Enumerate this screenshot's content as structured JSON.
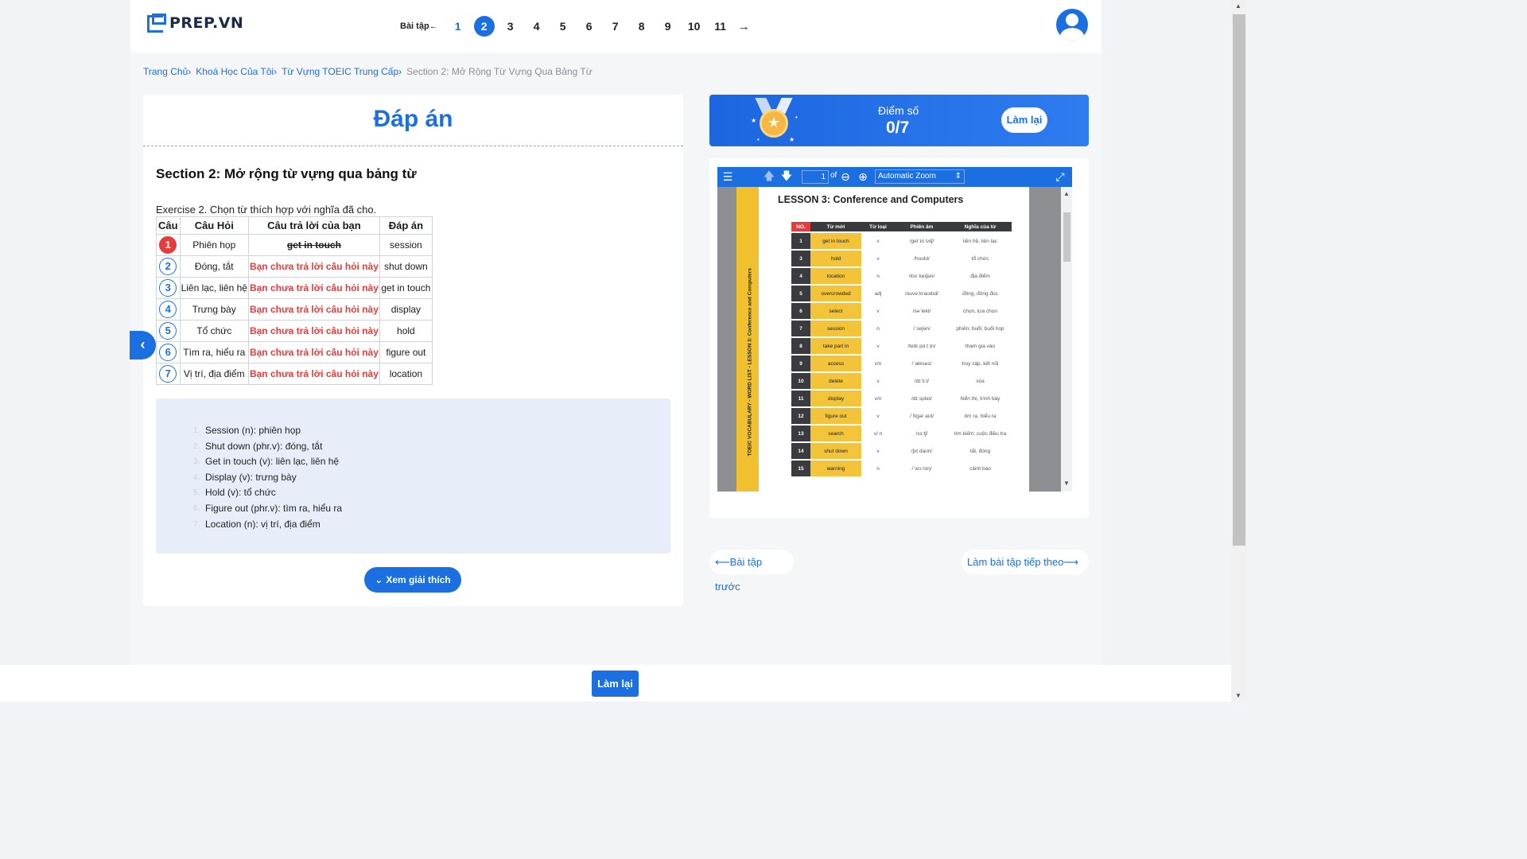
{
  "header": {
    "logo_text": "PREP.VN",
    "exercise_label": "Bài tập",
    "exercise_prev": "←",
    "exercise_next": "→",
    "exercises": [
      "1",
      "2",
      "3",
      "4",
      "5",
      "6",
      "7",
      "8",
      "9",
      "10",
      "11"
    ],
    "active_exercise": "2"
  },
  "breadcrumb": [
    "Trang Chủ",
    "Khoá Học Của Tôi",
    "Từ Vựng TOEIC Trung Cấp",
    "Section 2: Mở Rộng Từ Vựng Qua Bảng Từ"
  ],
  "answer": {
    "title": "Đáp án",
    "section_title": "Section 2: Mở rộng từ vựng qua bảng từ",
    "exercise_text": "Exercise 2. Chọn từ thích hợp với nghĩa đã cho.",
    "columns": [
      "Câu",
      "Câu Hỏi",
      "Câu trả lời của bạn",
      "Đáp án"
    ],
    "rows": [
      {
        "no": "1",
        "question": "Phiên họp",
        "your_answer": "get in touch",
        "correct": "session"
      },
      {
        "no": "2",
        "question": "Đóng, tắt",
        "your_answer": "Bạn chưa trả lời câu hỏi này",
        "correct": "shut down"
      },
      {
        "no": "3",
        "question": "Liên lạc, liên hệ",
        "your_answer": "Bạn chưa trả lời câu hỏi này",
        "correct": "get in touch"
      },
      {
        "no": "4",
        "question": "Trưng bày",
        "your_answer": "Bạn chưa trả lời câu hỏi này",
        "correct": "display"
      },
      {
        "no": "5",
        "question": "Tổ chức",
        "your_answer": "Bạn chưa trả lời câu hỏi này",
        "correct": "hold"
      },
      {
        "no": "6",
        "question": "Tìm ra, hiểu ra",
        "your_answer": "Bạn chưa trả lời câu hỏi này",
        "correct": "figure out"
      },
      {
        "no": "7",
        "question": "Vị trí, địa điểm",
        "your_answer": "Bạn chưa trả lời câu hỏi này",
        "correct": "location"
      }
    ],
    "explanations": [
      "Session (n): phiên họp",
      "Shut down (phr.v): đóng, tắt",
      "Get in touch (v): liên lạc, liên hệ",
      "Display (v): trưng bày",
      "Hold (v): tổ chức",
      "Figure out (phr.v): tìm ra, hiểu ra",
      "Location (n): vị trí, địa điểm"
    ],
    "explain_button": "Xem giải thích"
  },
  "score": {
    "label": "Điểm số",
    "value": "0/7",
    "retry": "Làm lại"
  },
  "pdf": {
    "page": "1",
    "of": "of",
    "zoom": "Automatic Zoom",
    "side_text": "TOEIC VOCABULARY - WORD LIST - LESSON 3: Conference and Computers",
    "title": "LESSON 3: Conference and Computers",
    "headers": [
      "NO.",
      "Từ mới",
      "Từ loại",
      "Phiên âm",
      "Nghĩa của từ"
    ],
    "rows": [
      [
        "1",
        "get in touch",
        "v",
        "/ɡet ɪn tʌtʃ/",
        "liên hệ, liên lạc"
      ],
      [
        "3",
        "hold",
        "v",
        "/hoʊld/",
        "tổ chức"
      ],
      [
        "4",
        "location",
        "n",
        "/loʊˈkeɪʃən/",
        "địa điểm"
      ],
      [
        "5",
        "overcrowded",
        "adj",
        "/oʊvəˈkraʊdɪd/",
        "đông, đông đúc"
      ],
      [
        "6",
        "select",
        "v",
        "/səˈlekt/",
        "chọn, lựa chọn"
      ],
      [
        "7",
        "session",
        "n",
        "/ˈseʃən/",
        "phiên; buổi; buổi họp"
      ],
      [
        "8",
        "take part in",
        "v",
        "/teɪk pɑːt ɪn/",
        "tham gia vào"
      ],
      [
        "9",
        "access",
        "v/n",
        "/ˈækses/",
        "truy cập, kết nối"
      ],
      [
        "10",
        "delete",
        "v",
        "/dɪˈliːt/",
        "xóa"
      ],
      [
        "11",
        "display",
        "v/n",
        "/dɪˈspleɪ/",
        "hiển thị, trình bày"
      ],
      [
        "12",
        "figure out",
        "v",
        "/ˈfɪɡər aʊt/",
        "tìm ra, hiểu ra"
      ],
      [
        "13",
        "search",
        "v/ n",
        "/sɜːtʃ/",
        "tìm kiếm; cuộc điều tra"
      ],
      [
        "14",
        "shut down",
        "v",
        "/ʃʌt daʊn/",
        "tắt, đóng"
      ],
      [
        "15",
        "warning",
        "n",
        "/ˈwɔːnɪŋ/",
        "cảnh báo"
      ]
    ]
  },
  "nav": {
    "prev": "Bài tập trước",
    "next": "Làm bài tập tiếp theo"
  },
  "footer": {
    "retry": "Làm lại"
  }
}
